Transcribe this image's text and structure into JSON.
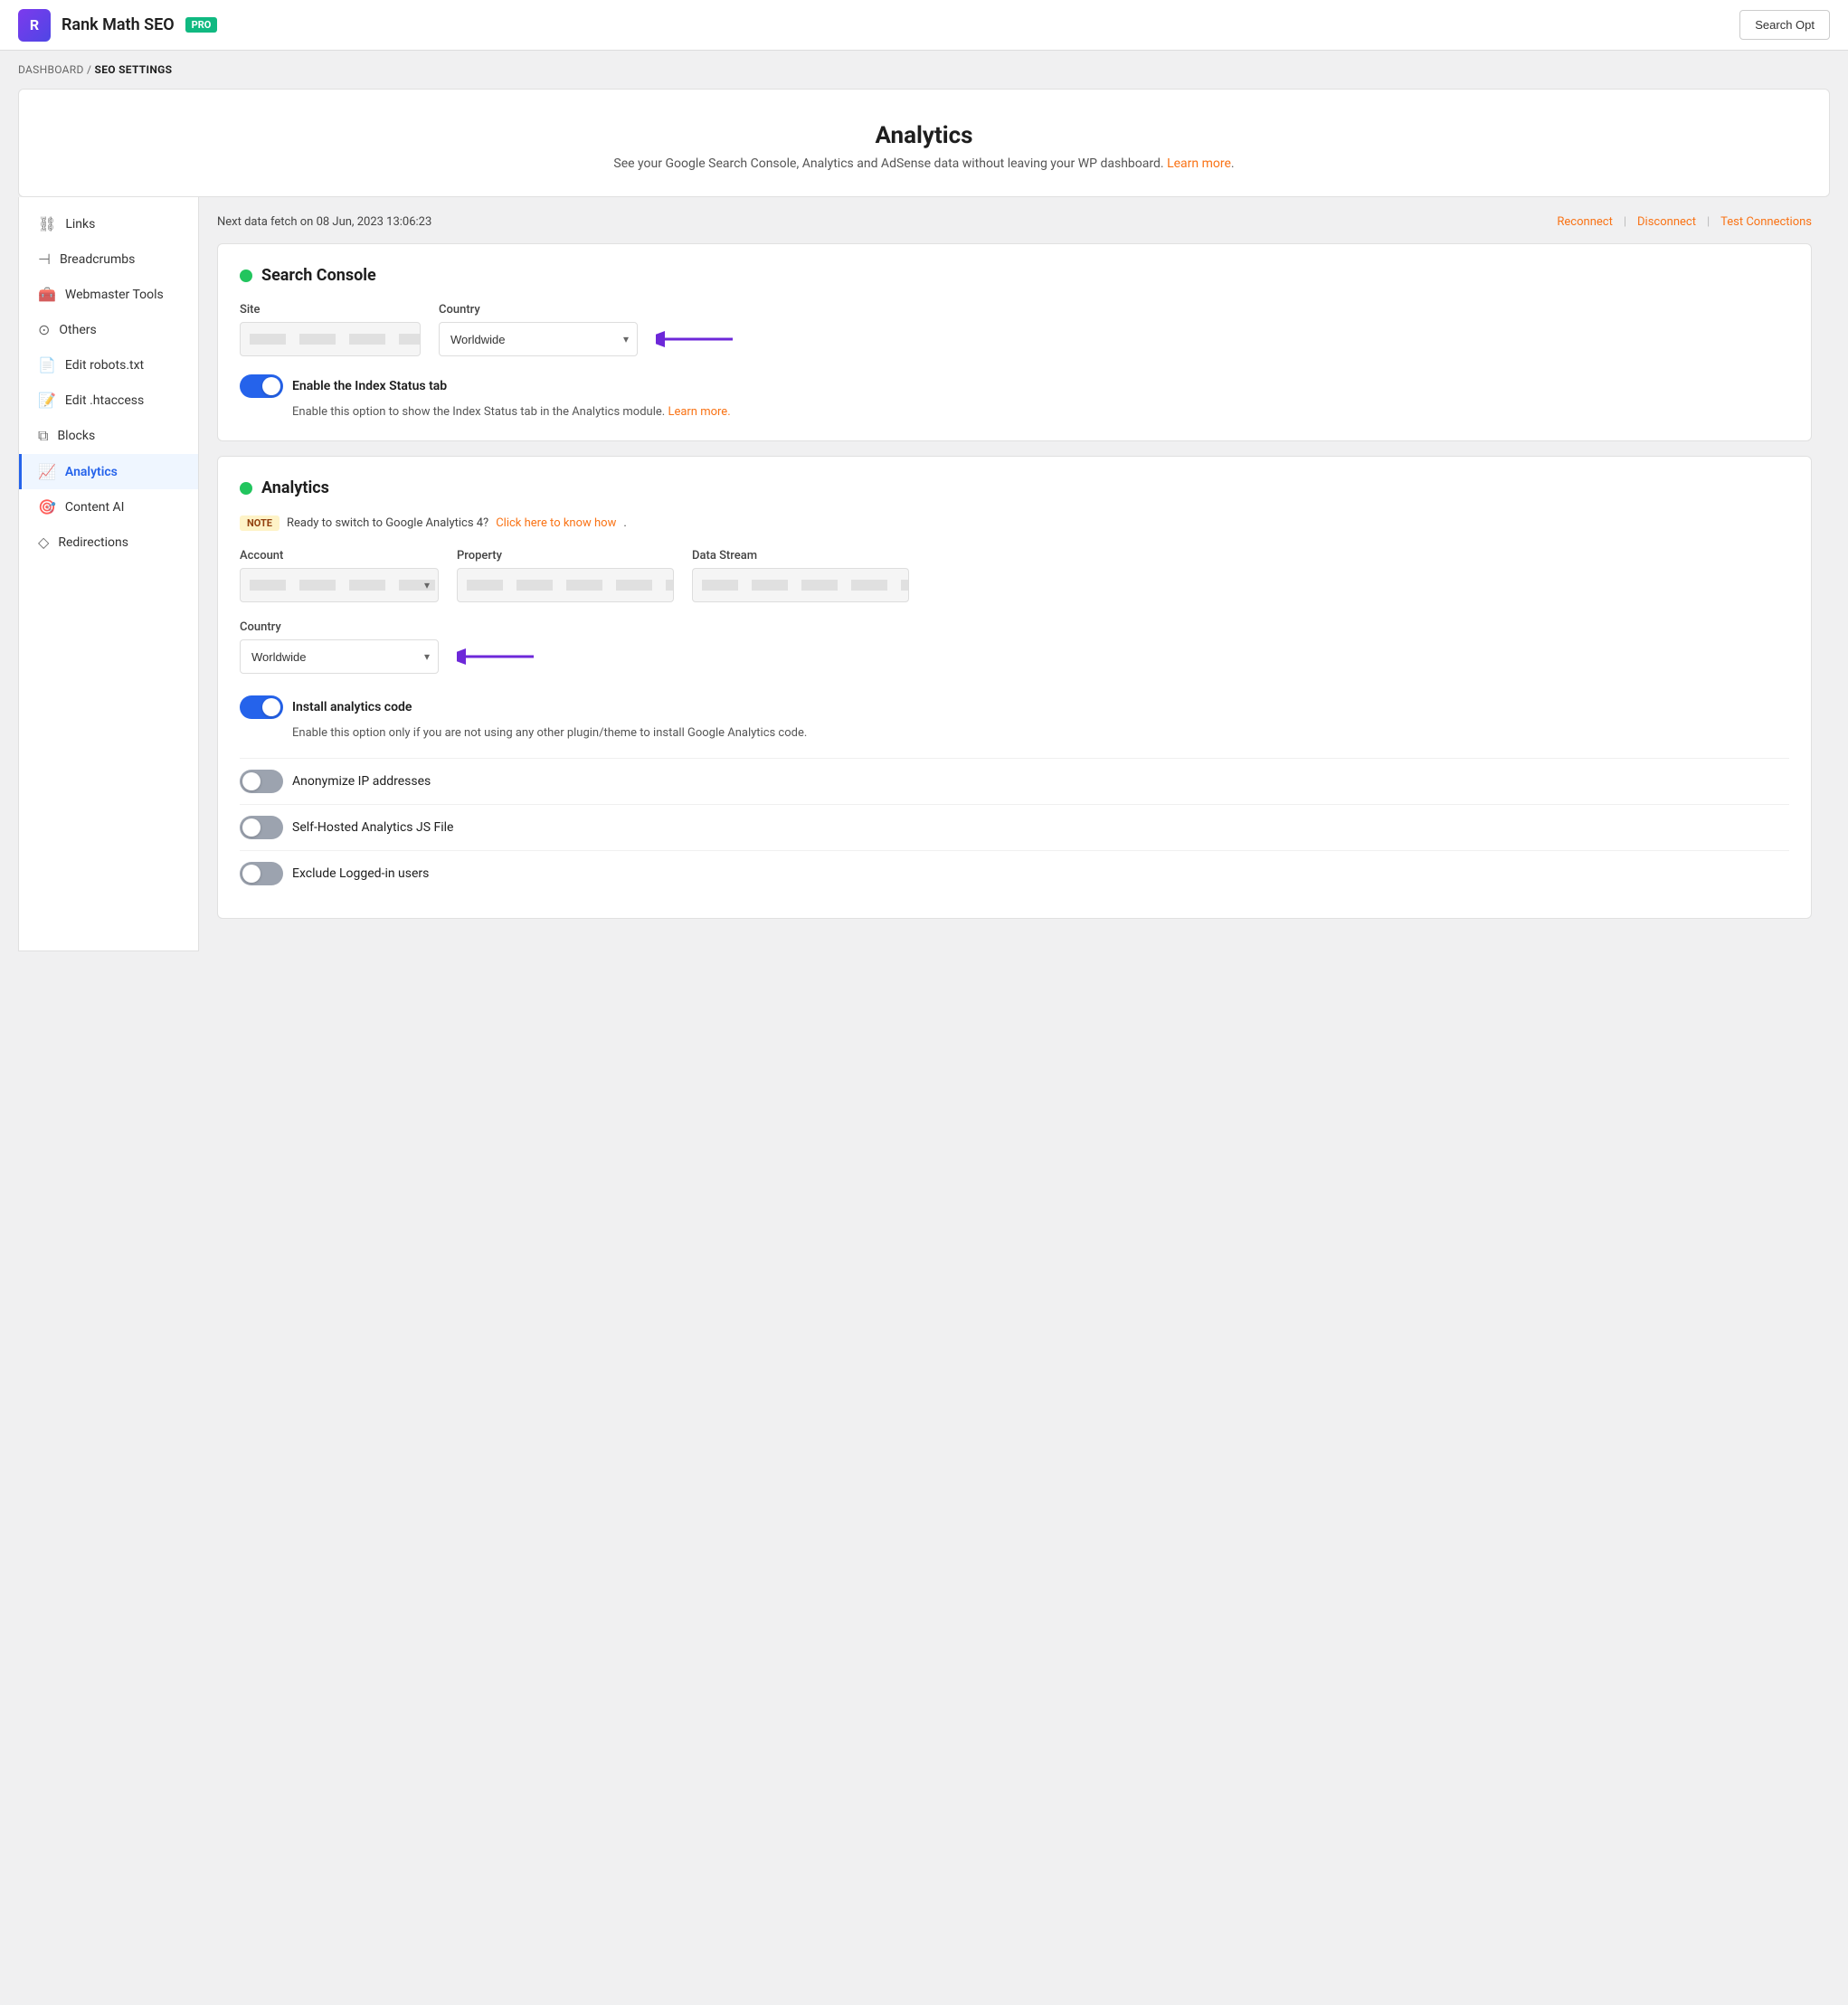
{
  "header": {
    "logo_text": "R",
    "app_title": "Rank Math SEO",
    "pro_label": "PRO",
    "search_opt_label": "Search Opt"
  },
  "breadcrumb": {
    "parent": "DASHBOARD",
    "separator": "/",
    "current": "SEO SETTINGS"
  },
  "hero": {
    "title": "Analytics",
    "description": "See your Google Search Console, Analytics and AdSense data without leaving your WP dashboard.",
    "learn_more": "Learn more",
    "period_after": "."
  },
  "fetch_bar": {
    "text": "Next data fetch on 08 Jun, 2023 13:06:23",
    "reconnect": "Reconnect",
    "disconnect": "Disconnect",
    "test_connections": "Test Connections"
  },
  "sidebar": {
    "items": [
      {
        "id": "links",
        "label": "Links",
        "icon": "⛓"
      },
      {
        "id": "breadcrumbs",
        "label": "Breadcrumbs",
        "icon": "⊣"
      },
      {
        "id": "webmaster-tools",
        "label": "Webmaster Tools",
        "icon": "🧰"
      },
      {
        "id": "others",
        "label": "Others",
        "icon": "⊙"
      },
      {
        "id": "edit-robots",
        "label": "Edit robots.txt",
        "icon": "📄"
      },
      {
        "id": "edit-htaccess",
        "label": "Edit .htaccess",
        "icon": "📝"
      },
      {
        "id": "blocks",
        "label": "Blocks",
        "icon": "⧉"
      },
      {
        "id": "analytics",
        "label": "Analytics",
        "icon": "📈"
      },
      {
        "id": "content-ai",
        "label": "Content AI",
        "icon": "🎯"
      },
      {
        "id": "redirections",
        "label": "Redirections",
        "icon": "◇"
      }
    ]
  },
  "search_console": {
    "title": "Search Console",
    "site_label": "Site",
    "country_label": "Country",
    "country_value": "Worldwide",
    "toggle_label": "Enable the Index Status tab",
    "toggle_desc": "Enable this option to show the Index Status tab in the Analytics module.",
    "toggle_learn_more": "Learn more.",
    "toggle_state": "on"
  },
  "analytics_section": {
    "title": "Analytics",
    "note_label": "Note",
    "note_text": "Ready to switch to Google Analytics 4?",
    "note_link": "Click here to know how",
    "note_period": ".",
    "account_label": "Account",
    "property_label": "Property",
    "data_stream_label": "Data Stream",
    "country_label": "Country",
    "country_value": "Worldwide",
    "install_analytics_label": "Install analytics code",
    "install_analytics_desc": "Enable this option only if you are not using any other plugin/theme to install Google Analytics code.",
    "install_toggle_state": "on",
    "anonymize_label": "Anonymize IP addresses",
    "anonymize_state": "off",
    "self_hosted_label": "Self-Hosted Analytics JS File",
    "self_hosted_state": "off",
    "exclude_label": "Exclude Logged-in users",
    "exclude_state": "off"
  }
}
